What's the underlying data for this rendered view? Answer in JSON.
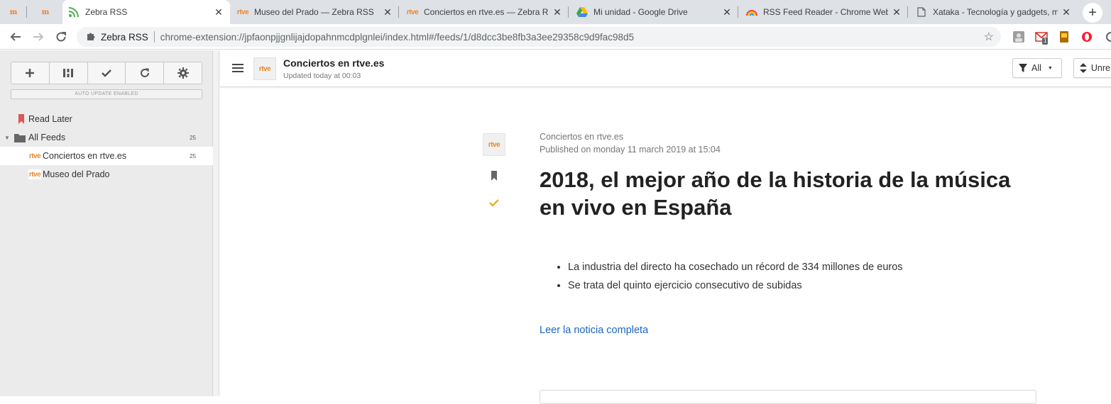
{
  "tabs": [
    {
      "title": "",
      "icon": "moodle-icon",
      "pinned": true
    },
    {
      "title": "",
      "icon": "moodle-icon",
      "pinned": true
    },
    {
      "title": "Zebra RSS",
      "icon": "rss-feed-icon",
      "active": true
    },
    {
      "title": "Museo del Prado — Zebra RSS",
      "icon": "rtve-icon"
    },
    {
      "title": "Conciertos en rtve.es — Zebra RSS",
      "icon": "rtve-icon"
    },
    {
      "title": "Mi unidad - Google Drive",
      "icon": "google-drive-icon"
    },
    {
      "title": "RSS Feed Reader - Chrome Web Store",
      "icon": "rainbow-icon"
    },
    {
      "title": "Xataka - Tecnología y gadgets, m",
      "icon": "document-icon"
    }
  ],
  "browser": {
    "site_name": "Zebra RSS",
    "url": "chrome-extension://jpfaonpjjgnlijajdopahnmcdplgnlei/index.html#/feeds/1/d8dcc3be8fb3a3ee29358c9d9fac98d5",
    "gmail_badge": "1"
  },
  "favicon_text": {
    "moodle": "m",
    "rtve": "rtve"
  },
  "sidebar": {
    "auto_update": "AUTO UPDATE ENABLED",
    "items": [
      {
        "label": "Read Later",
        "count": ""
      },
      {
        "label": "All Feeds",
        "count": "25"
      },
      {
        "label": "Conciertos en rtve.es",
        "count": "25"
      },
      {
        "label": "Museo del Prado",
        "count": ""
      }
    ]
  },
  "header": {
    "feed_title": "Conciertos en rtve.es",
    "updated": "Updated today at 00:03",
    "filter_label": "All",
    "sort_label": "Unre"
  },
  "article": {
    "source": "Conciertos en rtve.es",
    "published": "Published on monday 11 march 2019 at 15:04",
    "title": "2018, el mejor año de la historia de la música en vivo en España",
    "bullets": [
      "La industria del directo ha cosechado un récord de 334 millones de euros",
      "Se trata del quinto ejercicio consecutivo de subidas"
    ],
    "link": "Leer la noticia completa"
  },
  "colors": {
    "accent_link": "#1a66c2",
    "rtve_orange": "#e8882a",
    "read_later_red": "#e05555",
    "check_gold": "#e8b03a"
  }
}
